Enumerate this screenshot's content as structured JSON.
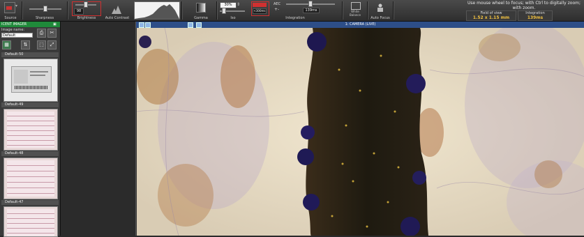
{
  "toolbar": {
    "source_label": "Source",
    "sharpness_label": "Sharpness",
    "brightness_label": "Brightness",
    "brightness_value": "98",
    "auto_contrast_label": "Auto Contrast",
    "gamma_label": "Gamma",
    "iso_label": "Iso",
    "zoom_value": "30%",
    "integration_label": "Integration",
    "integration_value": "139ms",
    "integration_max": "<300ms",
    "aec_label": "AEC",
    "white_balance_label": "White\nBalance",
    "auto_focus_label": "Auto Focus",
    "hint_text": "Use mouse wheel to focus; with Ctrl to digitally zoom; with zoom.",
    "field_of_view_label": "Field of view",
    "field_of_view_value": "1.52 x 1.15 mm",
    "integration_readout_label": "Integration",
    "integration_readout_value": "139ms"
  },
  "sidebar": {
    "header": "ICENT IMAGER",
    "image_name_label": "Image name:",
    "image_name_value": "Default",
    "thumbs": [
      {
        "label": "Default-50"
      },
      {
        "label": "Default-49"
      },
      {
        "label": "Default-48"
      },
      {
        "label": "Default-47"
      }
    ]
  },
  "view": {
    "title": "1: CAMERA (LIVE)"
  },
  "colors": {
    "panel_header": "#1f8a3a",
    "view_titlebar": "#2d4e88",
    "highlight": "#f0c040"
  }
}
